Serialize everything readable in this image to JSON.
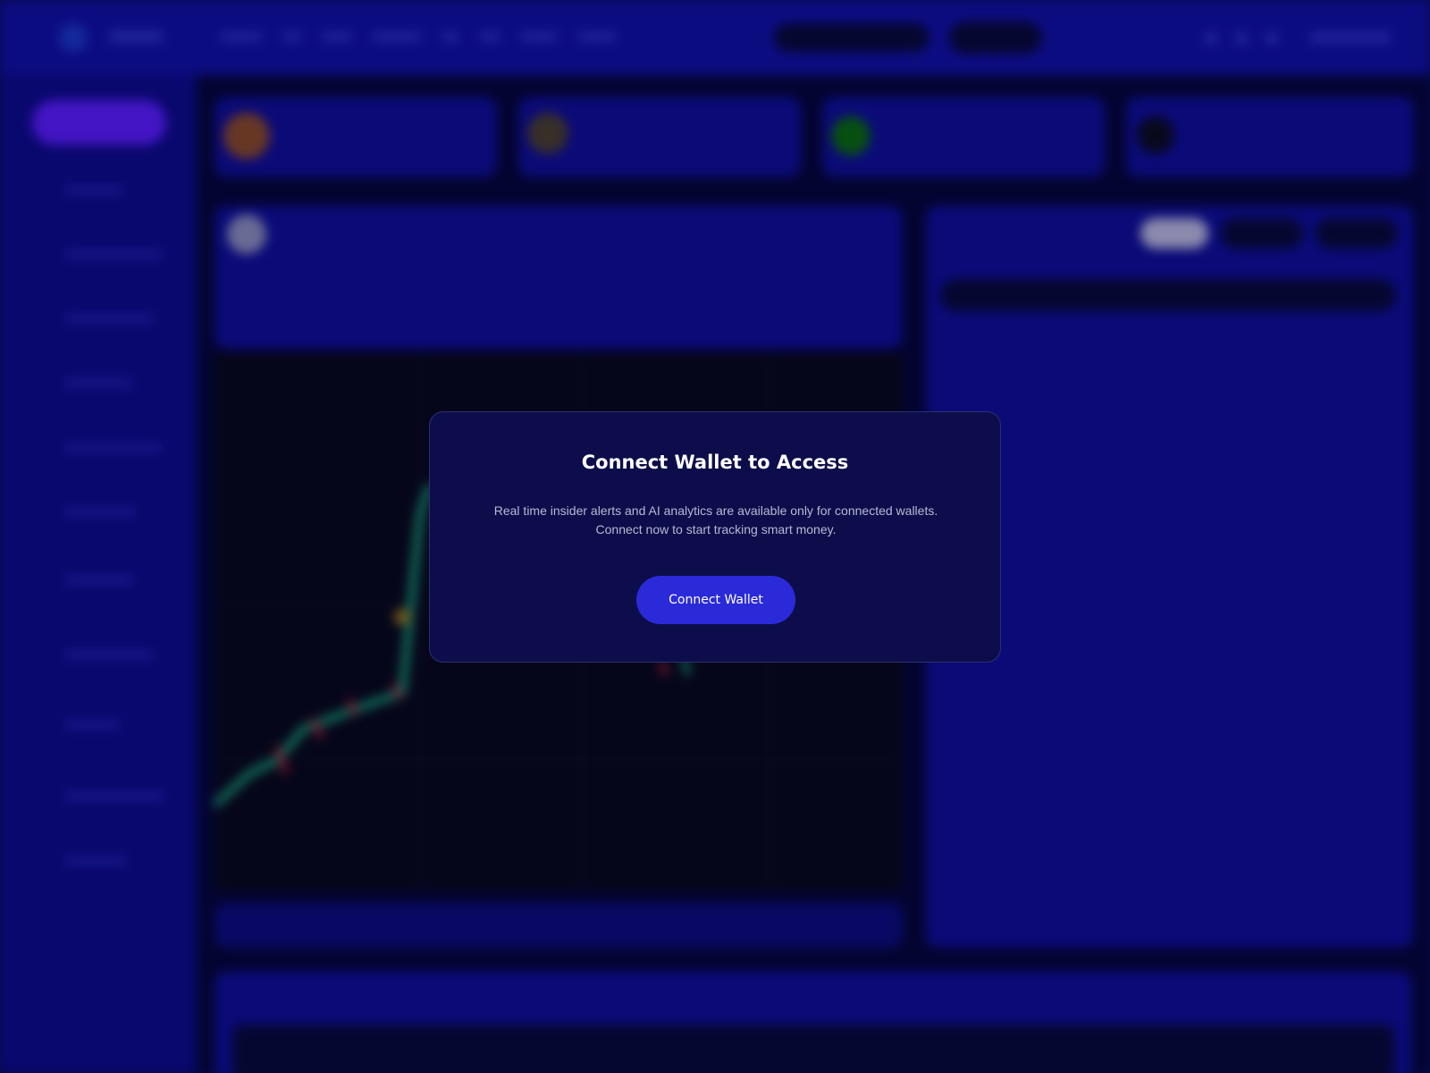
{
  "modal": {
    "title": "Connect Wallet to Access",
    "body_line1": "Real time insider alerts and AI analytics are available only for connected wallets.",
    "body_line2": "Connect now to start tracking smart money.",
    "button_label": "Connect Wallet"
  },
  "colors": {
    "background": "#0b0f5a",
    "topbar": "#1110a6",
    "modal_bg": "#0c0d4a",
    "button": "#2b2ad9",
    "accent_purple": "#5a1dff"
  }
}
